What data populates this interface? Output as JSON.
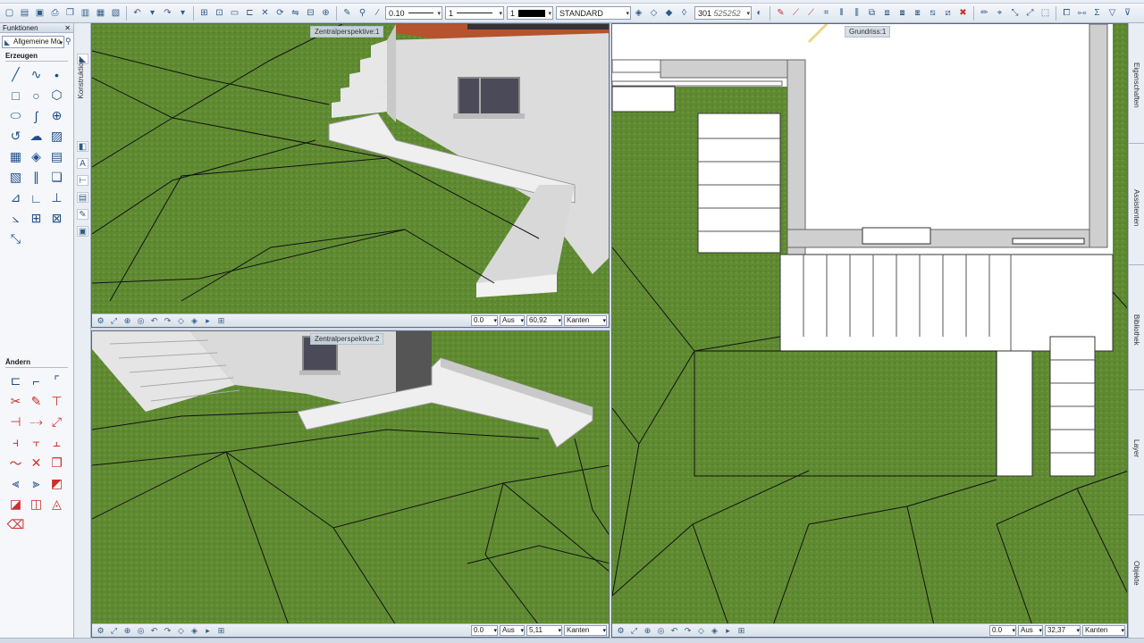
{
  "toolbar": {
    "pen_thickness": "0.10",
    "line_type": "1",
    "pen_color": "1",
    "layer_style": "STANDARD",
    "layer_number": "301",
    "layer_name": "525252"
  },
  "left_panel": {
    "title": "Funktionen",
    "close_glyph": "✕",
    "module_select": "Allgemeine Mo",
    "group_create": "Erzeugen",
    "group_modify": "Ändern",
    "side_tab": "Konstruktion"
  },
  "viewports": {
    "top_left": {
      "label": "Zentralperspektive:1",
      "angle": "0.0",
      "mode": "Aus",
      "zoom": "60,92",
      "render": "Kanten"
    },
    "bottom_left": {
      "label": "Zentralperspektive:2",
      "angle": "0.0",
      "mode": "Aus",
      "zoom": "5,11",
      "render": "Kanten"
    },
    "right": {
      "label": "Grundriss:1",
      "angle": "0.0",
      "mode": "Aus",
      "zoom": "32,37",
      "render": "Kanten"
    }
  },
  "right_dock": {
    "tabs": [
      "Eigenschaften",
      "Assistenten",
      "Bibliothek",
      "Layer",
      "Objekte"
    ]
  },
  "colors": {
    "grass": "#5f8a32",
    "wall": "#dcdcdc",
    "roof": "#b5532e",
    "accent": "#2f5b8a",
    "alert": "#c9302c"
  }
}
